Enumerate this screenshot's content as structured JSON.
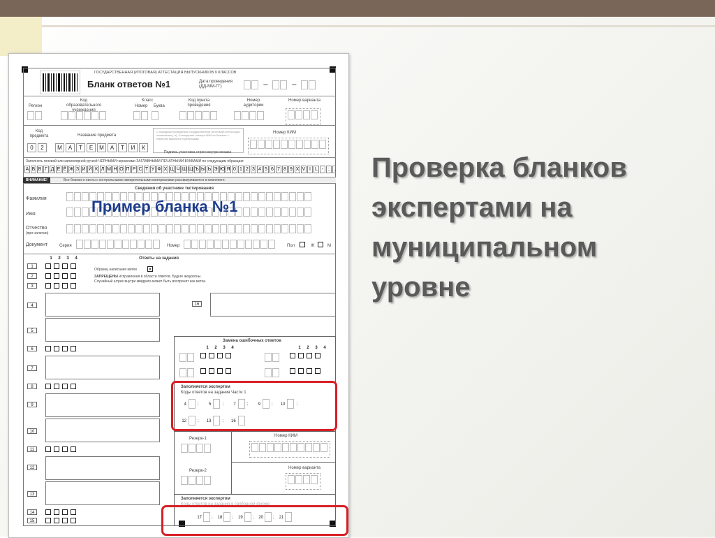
{
  "slide": {
    "title": "Проверка бланков экспертами на муниципальном уровне",
    "overlay_label": "Пример бланка №1",
    "colors": {
      "bar": "#7a6658",
      "accent": "#f3edc8",
      "title": "#5a5a5a",
      "overlay": "#1c3c8c",
      "highlight": "#d81f26"
    }
  },
  "form": {
    "header_top": "ГОСУДАРСТВЕННАЯ (ИТОГОВАЯ) АТТЕСТАЦИЯ ВЫПУСКНИКОВ 9 КЛАССОВ",
    "title": "Бланк ответов №1",
    "date_label": "Дата проведения (ДД-ММ-ГГ)",
    "row1": {
      "region": "Регион",
      "school_code": "Код образовательного учреждения",
      "class_label": "Класс",
      "class_number": "Номер",
      "class_letter": "Буква",
      "point_code": "Код пункта проведения",
      "room_number": "Номер аудитории",
      "variant_number": "Номер варианта"
    },
    "row2": {
      "subject_code_label": "Код предмета",
      "subject_name_label": "Название предмета",
      "subject_code_value": [
        "0",
        "2"
      ],
      "subject_name_value": [
        "М",
        "А",
        "Т",
        "Е",
        "М",
        "А",
        "Т",
        "И",
        "К"
      ],
      "signature_note": "С порядком проведения государственной (итоговой) аттестации ознакомлен (-а). Совпадение номера КИМ на бланках с номером варианта подтверждаю",
      "signature_label": "Подпись участника строго внутри окошка",
      "kim_number": "Номер КИМ"
    },
    "sample_instruction": "Заполнять гелевой или капиллярной ручкой ЧЁРНЫМИ чернилами ЗАГЛАВНЫМИ ПЕЧАТНЫМИ БУКВАМИ по следующим образцам:",
    "sample_chars": [
      "А",
      "Б",
      "В",
      "Г",
      "Д",
      "Е",
      "Ё",
      "Ж",
      "З",
      "И",
      "Й",
      "К",
      "Л",
      "М",
      "Н",
      "О",
      "П",
      "Р",
      "С",
      "Т",
      "У",
      "Ф",
      "Х",
      "Ц",
      "Ч",
      "Ш",
      "Щ",
      "Ъ",
      "Ы",
      "Ь",
      "Э",
      "Ю",
      "Я",
      "0",
      "1",
      "2",
      "3",
      "4",
      "5",
      "6",
      "7",
      "8",
      "9",
      "X",
      "V",
      "I",
      "L",
      "-",
      ";",
      ","
    ],
    "attention_label": "ВНИМАНИЕ!",
    "attention_text": "Все бланки и листы с контрольными измерительными материалами рассматриваются в комплекте.",
    "participant_header": "Сведения об участнике тестирования",
    "surname": "Фамилия",
    "name": "Имя",
    "patronymic": "Отчество",
    "patronymic_note": "(при наличии)",
    "document": "Документ",
    "series": "Серия",
    "number": "Номер",
    "gender": "Пол",
    "gender_f": "Ж",
    "gender_m": "М",
    "answers_header": "Ответы на задания",
    "answer_cols": [
      "1",
      "2",
      "3",
      "4"
    ],
    "sample_mark": "Образец написания метки",
    "forbidden_bold": "ЗАПРЕЩЕНЫ",
    "forbidden_text": "исправления в области ответов. Будьте аккуратны.",
    "forbidden_text2": "Случайный штрих внутри квадрата может быть воспринят как метка.",
    "task_numbers": [
      "1",
      "2",
      "3",
      "4",
      "5",
      "6",
      "7",
      "8",
      "9",
      "10",
      "11",
      "12",
      "13",
      "14",
      "15",
      "16"
    ],
    "replace_header": "Замена ошибочных ответов",
    "expert_fill": "Заполняется экспертом",
    "expert_codes": "Коды ответов на задания Части 1",
    "expert_items_a": [
      "4",
      "5",
      "7",
      "9",
      "10"
    ],
    "expert_items_b": [
      "12",
      "13",
      "16"
    ],
    "reserve1": "Резерв-1",
    "reserve2": "Резерв-2",
    "kim_number2": "Номер КИМ",
    "variant_number2": "Номер варианта",
    "expert_fill2": "Заполняется экспертом",
    "expert_codes2": "Коды ответов на задания в свободной форме",
    "expert_items_c": [
      "17",
      "18",
      "19",
      "20",
      "21"
    ]
  }
}
